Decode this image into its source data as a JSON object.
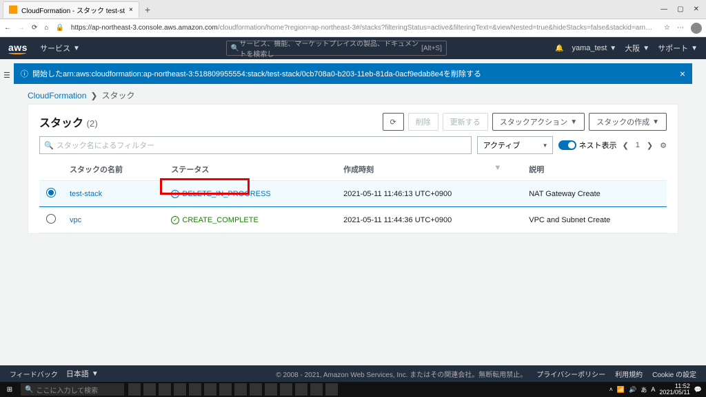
{
  "browser": {
    "tab_title": "CloudFormation - スタック test-st",
    "url_host": "https://ap-northeast-3.console.aws.amazon.com",
    "url_path": "/cloudformation/home?region=ap-northeast-3#/stacks?filteringStatus=active&filteringText=&viewNested=true&hideStacks=false&stackid=arn%3Aaw..."
  },
  "awsbar": {
    "services": "サービス",
    "search_placeholder": "サービス、機能、マーケットプレイスの製品、ドキュメントを検索し",
    "search_shortcut": "[Alt+S]",
    "user": "yama_test",
    "region": "大阪",
    "support": "サポート"
  },
  "notification": {
    "text": "開始したarn:aws:cloudformation:ap-northeast-3:518809955554:stack/test-stack/0cb708a0-b203-11eb-81da-0acf9edab8e4を削除する"
  },
  "breadcrumb": {
    "root": "CloudFormation",
    "current": "スタック"
  },
  "panel": {
    "title": "スタック",
    "count": "(2)",
    "btn_refresh": "C",
    "btn_delete": "削除",
    "btn_update": "更新する",
    "btn_stack_action": "スタックアクション",
    "btn_create": "スタックの作成"
  },
  "filter": {
    "placeholder": "スタック名によるフィルター",
    "dropdown": "アクティブ",
    "toggle_label": "ネスト表示",
    "page": "1"
  },
  "columns": {
    "name": "スタックの名前",
    "status": "ステータス",
    "created": "作成時刻",
    "desc": "説明"
  },
  "rows": [
    {
      "selected": true,
      "name": "test-stack",
      "status": "DELETE_IN_PROGRESS",
      "status_kind": "prog",
      "created": "2021-05-11 11:46:13 UTC+0900",
      "desc": "NAT Gateway Create"
    },
    {
      "selected": false,
      "name": "vpc",
      "status": "CREATE_COMPLETE",
      "status_kind": "ok",
      "created": "2021-05-11 11:44:36 UTC+0900",
      "desc": "VPC and Subnet Create"
    }
  ],
  "footer": {
    "feedback": "フィードバック",
    "lang": "日本語",
    "copyright": "© 2008 - 2021, Amazon Web Services, Inc. またはその関連会社。無断転用禁止。",
    "privacy": "プライバシーポリシー",
    "terms": "利用規約",
    "cookie": "Cookie の設定"
  },
  "taskbar": {
    "search": "ここに入力して検索",
    "time": "11:52",
    "date": "2021/05/11",
    "ime": "あ"
  }
}
